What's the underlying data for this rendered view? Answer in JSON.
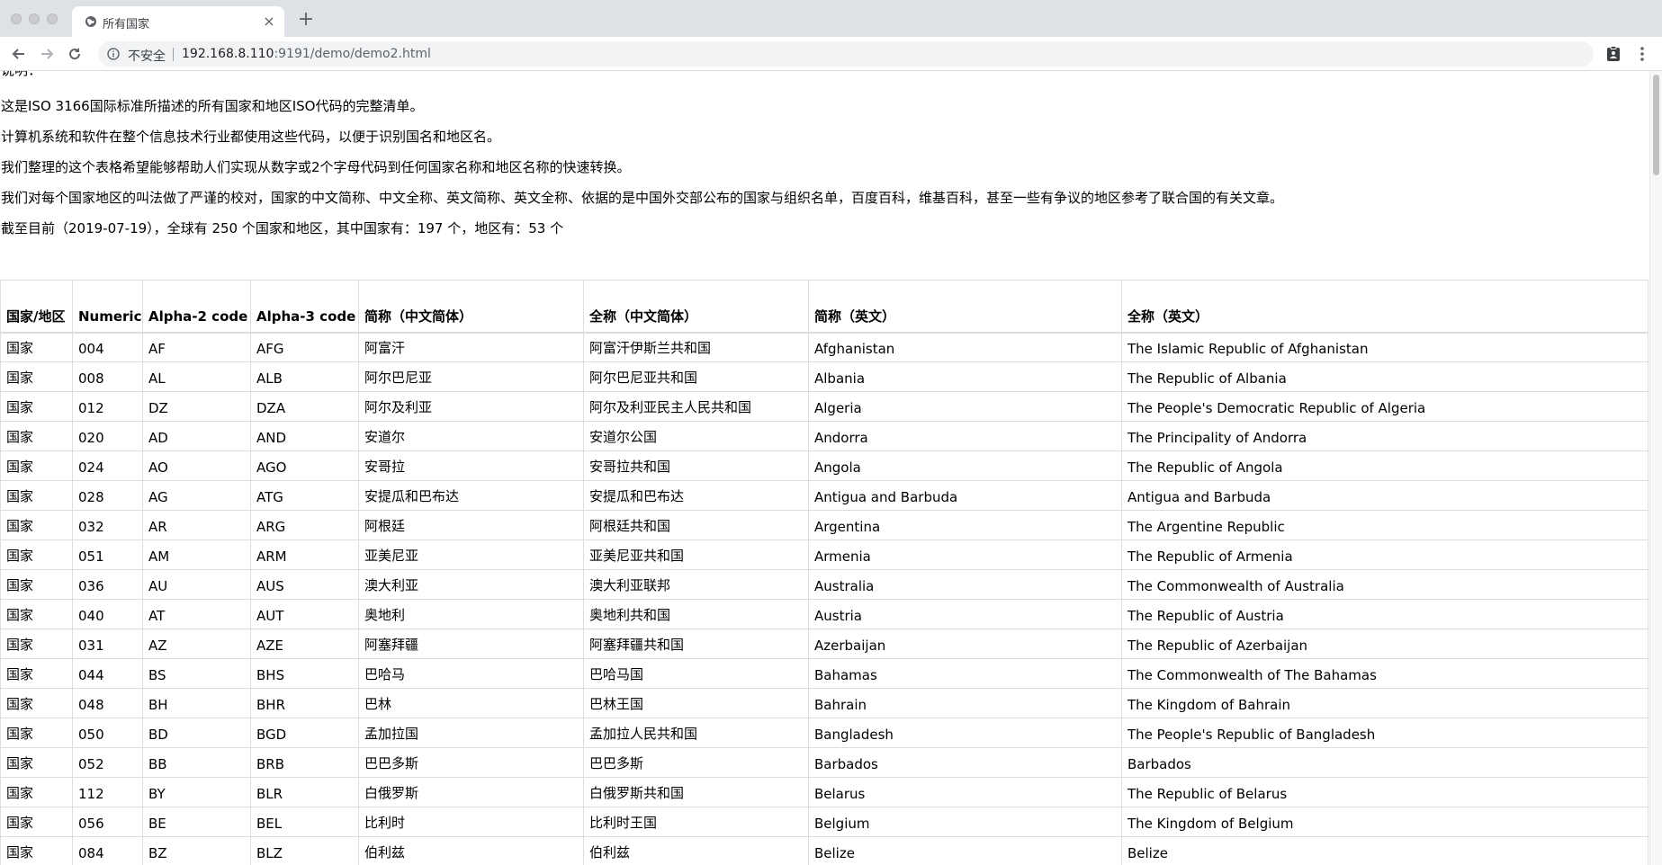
{
  "browser": {
    "tab_title": "所有国家",
    "tab_close": "×",
    "new_tab": "+",
    "security_label": "不安全",
    "url_host": "192.168.8.110",
    "url_rest": ":9191/demo/demo2.html"
  },
  "intro": {
    "heading": "说明：",
    "p1": "这是ISO 3166国际标准所描述的所有国家和地区ISO代码的完整清单。",
    "p2": "计算机系统和软件在整个信息技术行业都使用这些代码，以便于识别国名和地区名。",
    "p3": "我们整理的这个表格希望能够帮助人们实现从数字或2个字母代码到任何国家名称和地区名称的快速转换。",
    "p4": "我们对每个国家地区的叫法做了严谨的校对，国家的中文简称、中文全称、英文简称、英文全称、依据的是中国外交部公布的国家与组织名单，百度百科，维基百科，甚至一些有争议的地区参考了联合国的有关文章。",
    "p5": "截至目前（2019-07-19），全球有 250 个国家和地区，其中国家有：197 个，地区有：53 个"
  },
  "table": {
    "headers": [
      "国家/地区",
      "Numeric",
      "Alpha-2 code",
      "Alpha-3 code",
      "简称（中文简体）",
      "全称（中文简体）",
      "简称（英文）",
      "全称（英文）"
    ],
    "rows": [
      [
        "国家",
        "004",
        "AF",
        "AFG",
        "阿富汗",
        "阿富汗伊斯兰共和国",
        "Afghanistan",
        "The Islamic Republic of Afghanistan"
      ],
      [
        "国家",
        "008",
        "AL",
        "ALB",
        "阿尔巴尼亚",
        "阿尔巴尼亚共和国",
        "Albania",
        "The Republic of Albania"
      ],
      [
        "国家",
        "012",
        "DZ",
        "DZA",
        "阿尔及利亚",
        "阿尔及利亚民主人民共和国",
        "Algeria",
        "The People's Democratic Republic of Algeria"
      ],
      [
        "国家",
        "020",
        "AD",
        "AND",
        "安道尔",
        "安道尔公国",
        "Andorra",
        "The Principality of Andorra"
      ],
      [
        "国家",
        "024",
        "AO",
        "AGO",
        "安哥拉",
        "安哥拉共和国",
        "Angola",
        "The Republic of Angola"
      ],
      [
        "国家",
        "028",
        "AG",
        "ATG",
        "安提瓜和巴布达",
        "安提瓜和巴布达",
        "Antigua and Barbuda",
        "Antigua and Barbuda"
      ],
      [
        "国家",
        "032",
        "AR",
        "ARG",
        "阿根廷",
        "阿根廷共和国",
        "Argentina",
        "The Argentine Republic"
      ],
      [
        "国家",
        "051",
        "AM",
        "ARM",
        "亚美尼亚",
        "亚美尼亚共和国",
        "Armenia",
        "The Republic of Armenia"
      ],
      [
        "国家",
        "036",
        "AU",
        "AUS",
        "澳大利亚",
        "澳大利亚联邦",
        "Australia",
        "The Commonwealth of Australia"
      ],
      [
        "国家",
        "040",
        "AT",
        "AUT",
        "奥地利",
        "奥地利共和国",
        "Austria",
        "The Republic of Austria"
      ],
      [
        "国家",
        "031",
        "AZ",
        "AZE",
        "阿塞拜疆",
        "阿塞拜疆共和国",
        "Azerbaijan",
        "The Republic of Azerbaijan"
      ],
      [
        "国家",
        "044",
        "BS",
        "BHS",
        "巴哈马",
        "巴哈马国",
        "Bahamas",
        "The Commonwealth of The Bahamas"
      ],
      [
        "国家",
        "048",
        "BH",
        "BHR",
        "巴林",
        "巴林王国",
        "Bahrain",
        "The Kingdom of Bahrain"
      ],
      [
        "国家",
        "050",
        "BD",
        "BGD",
        "孟加拉国",
        "孟加拉人民共和国",
        "Bangladesh",
        "The People's Republic of Bangladesh"
      ],
      [
        "国家",
        "052",
        "BB",
        "BRB",
        "巴巴多斯",
        "巴巴多斯",
        "Barbados",
        "Barbados"
      ],
      [
        "国家",
        "112",
        "BY",
        "BLR",
        "白俄罗斯",
        "白俄罗斯共和国",
        "Belarus",
        "The Republic of Belarus"
      ],
      [
        "国家",
        "056",
        "BE",
        "BEL",
        "比利时",
        "比利时王国",
        "Belgium",
        "The Kingdom of Belgium"
      ],
      [
        "国家",
        "084",
        "BZ",
        "BLZ",
        "伯利兹",
        "伯利兹",
        "Belize",
        "Belize"
      ]
    ]
  }
}
